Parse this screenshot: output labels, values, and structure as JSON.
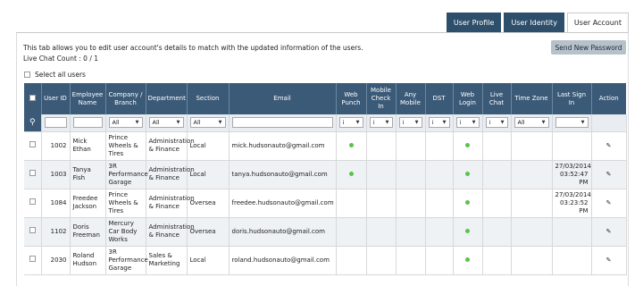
{
  "tabs": [
    {
      "label": "User Profile",
      "active": false
    },
    {
      "label": "User Identity",
      "active": false
    },
    {
      "label": "User Account",
      "active": true
    }
  ],
  "intro": {
    "line1": "This tab allows you to edit user account's details to match with the updated information of the users.",
    "live_chat": "Live Chat Count  : 0 / 1"
  },
  "send_button": "Send New Password",
  "select_all_label": "Select all users",
  "columns": [
    "User ID",
    "Employee Name",
    "Company / Branch",
    "Department",
    "Section",
    "Email",
    "Web Punch",
    "Mobile Check In",
    "Any Mobile",
    "DST",
    "Web Login",
    "Live Chat",
    "Time Zone",
    "Last Sign In",
    "Action"
  ],
  "filters": {
    "company": "All",
    "department": "All",
    "section": "All",
    "web_punch": "i",
    "mobile_check": "i",
    "any_mobile": "i",
    "dst": "i",
    "web_login": "i",
    "live_chat": "i",
    "time_zone": "All"
  },
  "colors": {
    "header": "#3b5a78",
    "tab": "#2e4f6b",
    "status_dot": "#5cc24a",
    "button": "#b7c1ca"
  },
  "icons": {
    "search": "search-icon",
    "edit": "pencil-icon",
    "dropdown": "chevron-down-icon"
  },
  "rows": [
    {
      "id": "1002",
      "name": "Mick Ethan",
      "company": "Prince Wheels & Tires",
      "department": "Administration & Finance",
      "section": "Local",
      "email": "mick.hudsonauto@gmail.com",
      "web_punch": true,
      "web_login": true,
      "last_sign_in": ""
    },
    {
      "id": "1003",
      "name": "Tanya Fish",
      "company": "3R Performance Garage",
      "department": "Administration & Finance",
      "section": "Local",
      "email": "tanya.hudsonauto@gmail.com",
      "web_punch": true,
      "web_login": true,
      "last_sign_in": "27/03/2014 03:52:47 PM"
    },
    {
      "id": "1084",
      "name": "Freedee Jackson",
      "company": "Prince Wheels & Tires",
      "department": "Administration & Finance",
      "section": "Oversea",
      "email": "freedee.hudsonauto@gmail.com",
      "web_punch": false,
      "web_login": true,
      "last_sign_in": "27/03/2014 03:23:52 PM"
    },
    {
      "id": "1102",
      "name": "Doris Freeman",
      "company": "Mercury Car Body Works",
      "department": "Administration & Finance",
      "section": "Oversea",
      "email": "doris.hudsonauto@gmail.com",
      "web_punch": false,
      "web_login": true,
      "last_sign_in": ""
    },
    {
      "id": "2030",
      "name": "Roland Hudson",
      "company": "3R Performance Garage",
      "department": "Sales & Marketing",
      "section": "Local",
      "email": "roland.hudsonauto@gmail.com",
      "web_punch": false,
      "web_login": true,
      "last_sign_in": ""
    }
  ]
}
